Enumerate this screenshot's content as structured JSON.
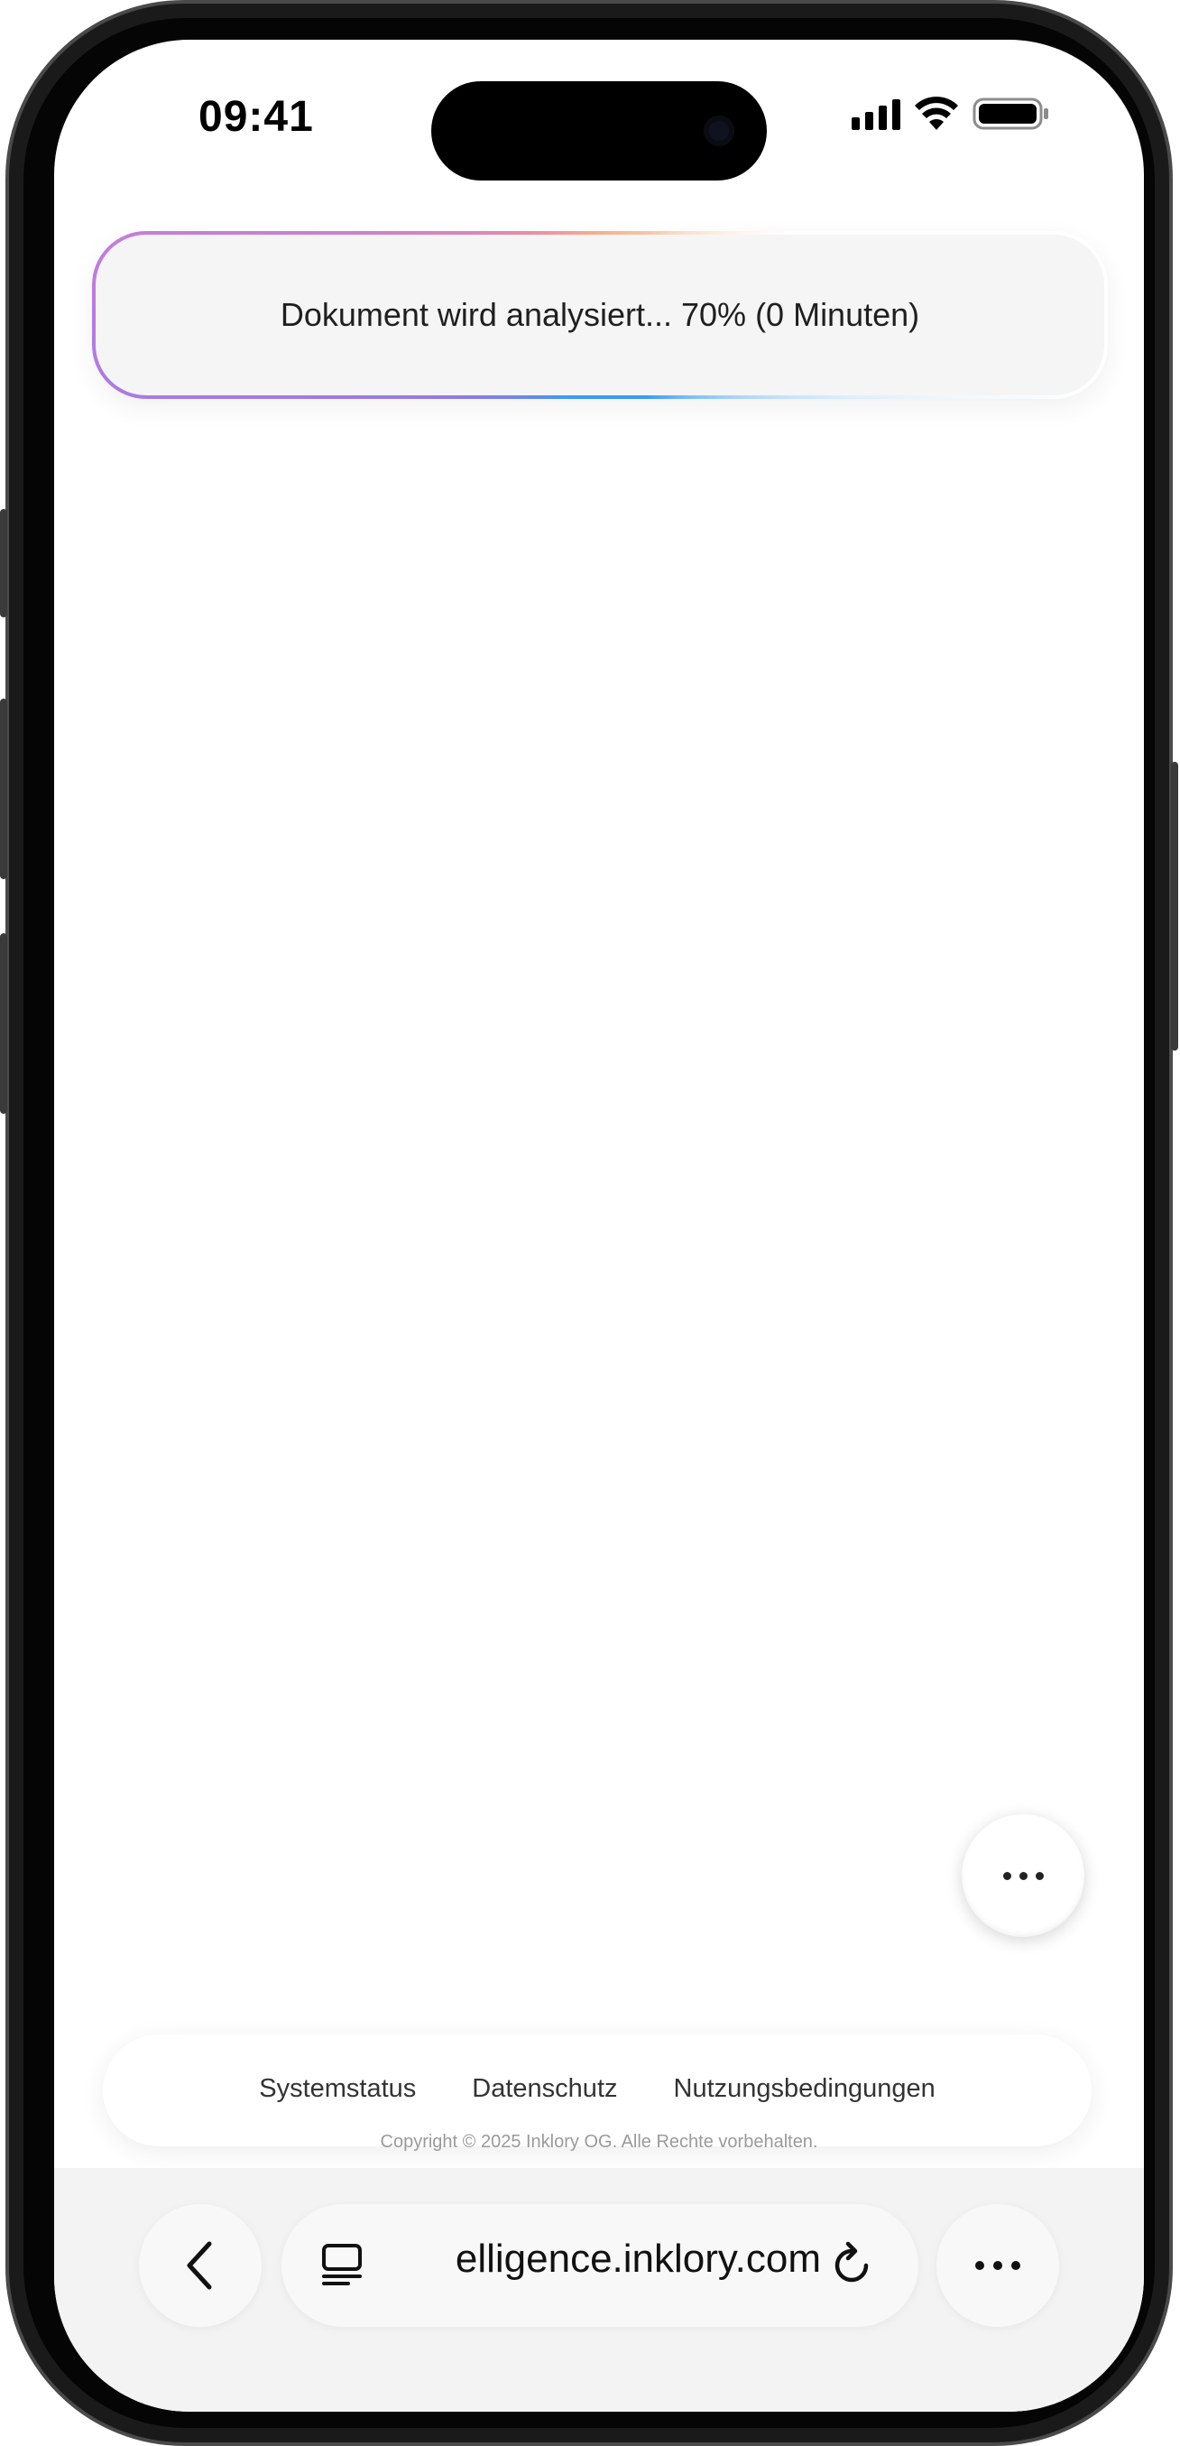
{
  "status_bar": {
    "time": "09:41",
    "signal_icon": "cellular-signal-icon",
    "wifi_icon": "wifi-icon",
    "battery_icon": "battery-icon"
  },
  "banner": {
    "text": "Dokument wird analysiert... 70% (0 Minuten)",
    "progress_percent": 70
  },
  "fab": {
    "icon": "more-horizontal-icon"
  },
  "footer": {
    "links": [
      "Systemstatus",
      "Datenschutz",
      "Nutzungsbedingungen"
    ],
    "copyright": "Copyright © 2025 Inklory OG. Alle Rechte vorbehalten."
  },
  "browser_toolbar": {
    "back_icon": "chevron-left-icon",
    "tabs_icon": "page-menu-icon",
    "url": "elligence.inklory.com",
    "reload_icon": "reload-icon",
    "menu_icon": "more-horizontal-icon"
  },
  "colors": {
    "gradient": [
      "#3a9bf7",
      "#8a7be6",
      "#c07be0",
      "#e88aa8",
      "#f6a98c",
      "#f7c4a0"
    ],
    "banner_bg": "#f5f5f5"
  }
}
